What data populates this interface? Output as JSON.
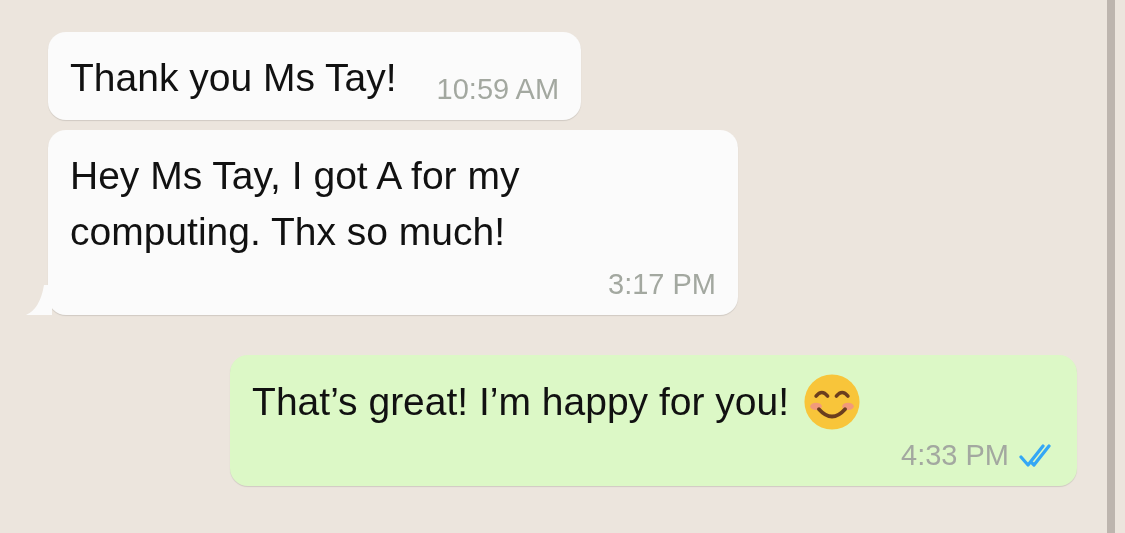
{
  "messages": [
    {
      "kind": "incoming",
      "text": "Thank you Ms Tay!",
      "time": "10:59 AM",
      "tail": false
    },
    {
      "kind": "incoming",
      "text": "Hey Ms Tay, I got A for my computing. Thx so much!",
      "time": "3:17 PM",
      "tail": true
    },
    {
      "kind": "outgoing",
      "text": "That’s great! I’m happy for you!",
      "time": "4:33 PM",
      "tail": false,
      "read": true,
      "emoji": true
    }
  ]
}
